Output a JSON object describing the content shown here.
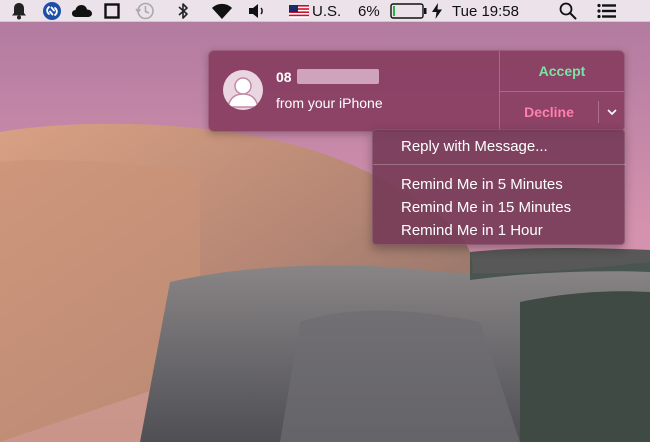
{
  "menubar": {
    "input_source": "U.S.",
    "battery_percent": "6%",
    "battery_level": 0.06,
    "clock": "Tue 19:58",
    "icons": [
      "notifications-icon",
      "shazam-icon",
      "cloud-icon",
      "square-icon",
      "time-machine-icon",
      "bluetooth-icon",
      "wifi-icon",
      "volume-icon",
      "us-flag-icon",
      "battery-icon",
      "charging-icon",
      "spotlight-icon",
      "list-icon"
    ]
  },
  "notification": {
    "title_visible": "08",
    "subtitle": "from your iPhone",
    "accept_label": "Accept",
    "decline_label": "Decline",
    "colors": {
      "accept": "#7de3a5",
      "decline": "#ff7fae"
    }
  },
  "dropdown": {
    "reply_label": "Reply with Message...",
    "items": [
      "Remind Me in 5 Minutes",
      "Remind Me in 15 Minutes",
      "Remind Me in 1 Hour"
    ]
  }
}
